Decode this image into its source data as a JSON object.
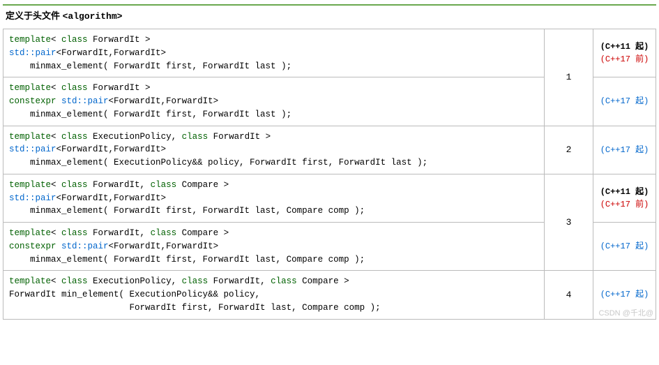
{
  "header": {
    "prefix": "定义于头文件 ",
    "file": "<algorithm>"
  },
  "rows": [
    {
      "num": "1",
      "cells": [
        {
          "code_html": "<span class='kw'>template</span>&lt; <span class='kw'>class</span> ForwardIt &gt;\n<span class='link'>std::pair</span>&lt;ForwardIt,ForwardIt&gt;\n    minmax_element( ForwardIt first, ForwardIt last );",
          "ver_html": "<span class='ver-bold'>(C++11 起)</span><br><span class='ver-red'>(C++17 前)</span>"
        },
        {
          "code_html": "<span class='kw'>template</span>&lt; <span class='kw'>class</span> ForwardIt &gt;\n<span class='kw'>constexpr</span> <span class='link'>std::pair</span>&lt;ForwardIt,ForwardIt&gt;\n    minmax_element( ForwardIt first, ForwardIt last );",
          "ver_html": "<span class='ver-link'>(C++17 起)</span>"
        }
      ]
    },
    {
      "num": "2",
      "cells": [
        {
          "code_html": "<span class='kw'>template</span>&lt; <span class='kw'>class</span> ExecutionPolicy, <span class='kw'>class</span> ForwardIt &gt;\n<span class='link'>std::pair</span>&lt;ForwardIt,ForwardIt&gt;\n    minmax_element( ExecutionPolicy&amp;&amp; policy, ForwardIt first, ForwardIt last );",
          "ver_html": "<span class='ver-link'>(C++17 起)</span>"
        }
      ]
    },
    {
      "num": "3",
      "cells": [
        {
          "code_html": "<span class='kw'>template</span>&lt; <span class='kw'>class</span> ForwardIt, <span class='kw'>class</span> Compare &gt;\n<span class='link'>std::pair</span>&lt;ForwardIt,ForwardIt&gt;\n    minmax_element( ForwardIt first, ForwardIt last, Compare comp );",
          "ver_html": "<span class='ver-bold'>(C++11 起)</span><br><span class='ver-red'>(C++17 前)</span>"
        },
        {
          "code_html": "<span class='kw'>template</span>&lt; <span class='kw'>class</span> ForwardIt, <span class='kw'>class</span> Compare &gt;\n<span class='kw'>constexpr</span> <span class='link'>std::pair</span>&lt;ForwardIt,ForwardIt&gt;\n    minmax_element( ForwardIt first, ForwardIt last, Compare comp );",
          "ver_html": "<span class='ver-link'>(C++17 起)</span>"
        }
      ]
    },
    {
      "num": "4",
      "cells": [
        {
          "code_html": "<span class='kw'>template</span>&lt; <span class='kw'>class</span> ExecutionPolicy, <span class='kw'>class</span> ForwardIt, <span class='kw'>class</span> Compare &gt;\nForwardIt min_element( ExecutionPolicy&amp;&amp; policy,\n                       ForwardIt first, ForwardIt last, Compare comp );",
          "ver_html": "<span class='ver-link'>(C++17 起)</span>"
        }
      ]
    }
  ],
  "watermark": "CSDN @千北@"
}
